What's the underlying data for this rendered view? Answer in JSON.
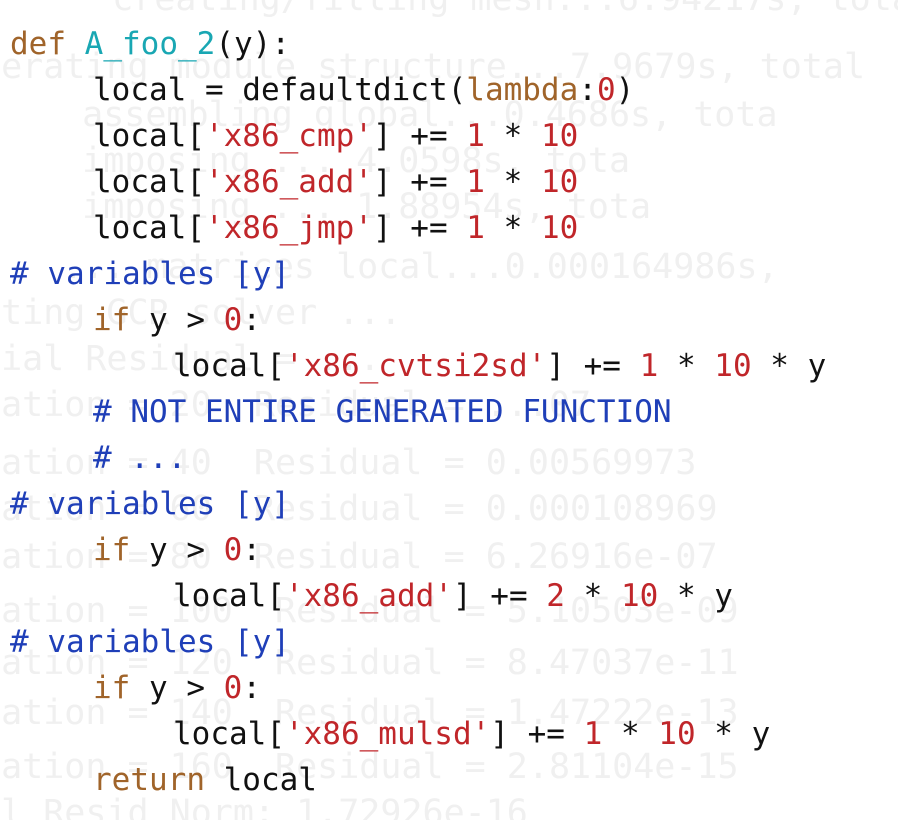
{
  "colors": {
    "keyword": "#a0642a",
    "function_name": "#19a7b3",
    "string": "#c0262a",
    "number": "#c0262a",
    "comment": "#1f3fb8",
    "text": "#111111",
    "background_log": "#f0f0f0"
  },
  "background_log": [
    "  creating/filling mesh...6.94217s, tota",
    "nerating module structure...7.9679s, total",
    "  assembling global...0.4686s, tota",
    "  imposing ... 4.0598s, tota",
    "  imposing ... 1.88954s, tota",
    "  ... matrices local...0.000164986s,",
    "rting GCR solver ...",
    "tial Residual = ...",
    "ration = 20  Residual = ...07",
    "ration = 40  Residual = 0.00569973",
    "ration = 60  Residual = 0.000108969",
    "ration = 80  Residual = 6.26916e-07",
    "ration = 100  Residual = 5.10503e-09",
    "ration = 120  Residual = 8.47037e-11",
    "ration = 140  Residual = 1.47222e-13",
    "ration = 160  Residual = 2.81104e-15",
    "al Resid Norm: 1.72926e-16"
  ],
  "code": {
    "keyword_def": "def",
    "function_name": "A_foo_2",
    "def_params": "(y):",
    "local_assign": "local = defaultdict(",
    "lambda_kw": "lambda",
    "lambda_colon": ":",
    "lambda_zero": "0",
    "close_paren": ")",
    "local_open": "local[",
    "close_bracket": "]",
    "plus_eq": " += ",
    "times": " * ",
    "str_cmp": "'x86_cmp'",
    "str_add": "'x86_add'",
    "str_jmp": "'x86_jmp'",
    "str_cvtsi2sd": "'x86_cvtsi2sd'",
    "str_mulsd": "'x86_mulsd'",
    "num_1": "1",
    "num_2": "2",
    "num_10": "10",
    "num_0": "0",
    "var_y": "y",
    "comment_variables": "# variables [y]",
    "kw_if": "if",
    "cond": " y > ",
    "colon": ":",
    "comment_not_entire": "# NOT ENTIRE GENERATED FUNCTION",
    "comment_ellipsis": "# ...",
    "kw_return": "return",
    "return_value": " local"
  }
}
